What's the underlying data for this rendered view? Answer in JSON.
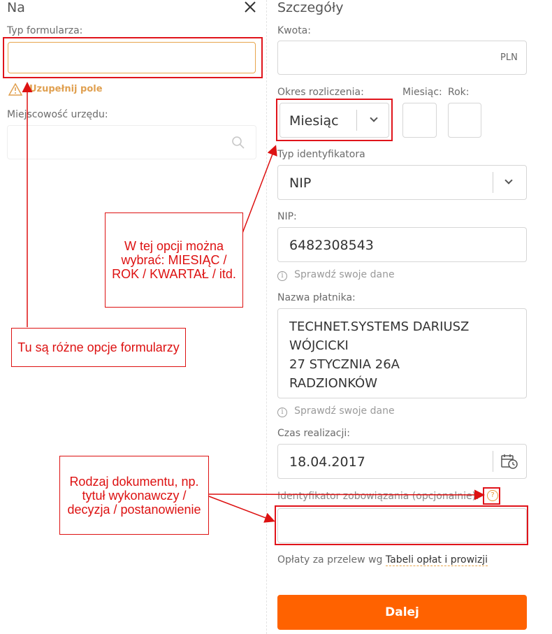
{
  "left": {
    "title": "Na",
    "form_type_label": "Typ formularza:",
    "form_type_value": "",
    "error_text": "Uzupełnij pole",
    "office_label": "Miejscowość urzędu:",
    "office_value": ""
  },
  "right": {
    "title": "Szczegóły",
    "amount_label": "Kwota:",
    "amount_value": "",
    "currency": "PLN",
    "period_label": "Okres rozliczenia:",
    "period_value": "Miesiąc",
    "month_label": "Miesiąc:",
    "month_value": "",
    "year_label": "Rok:",
    "year_value": "",
    "id_type_label": "Typ identyfikatora",
    "id_type_value": "NIP",
    "nip_label": "NIP:",
    "nip_value": "6482308543",
    "check_hint_1": "Sprawdź swoje dane",
    "payer_label": "Nazwa płatnika:",
    "payer_lines": [
      "TECHNET.SYSTEMS DARIUSZ",
      "WÓJCICKI",
      "27 STYCZNIA 26A",
      "RADZIONKÓW"
    ],
    "check_hint_2": "Sprawdź swoje dane",
    "date_label": "Czas realizacji:",
    "date_value": "18.04.2017",
    "obligation_label": "Identyfikator zobowiązania (opcjonalnie):",
    "obligation_help": "?",
    "obligation_value": "",
    "fees_text": "Opłaty za przelew wg",
    "fees_link": "Tabeli opłat i prowizji",
    "next_button": "Dalej"
  },
  "annotations": {
    "period_note": "W tej opcji można wybrać: MIESIĄC / ROK / KWARTAŁ / itd.",
    "form_note": "Tu są różne opcje formularzy",
    "doc_note": "Rodzaj dokumentu, np. tytuł wykonawczy / decyzja / postanowienie"
  },
  "colors": {
    "accent": "#ff6200",
    "error_label": "#e0a050",
    "annotation_red": "#dd1111"
  }
}
